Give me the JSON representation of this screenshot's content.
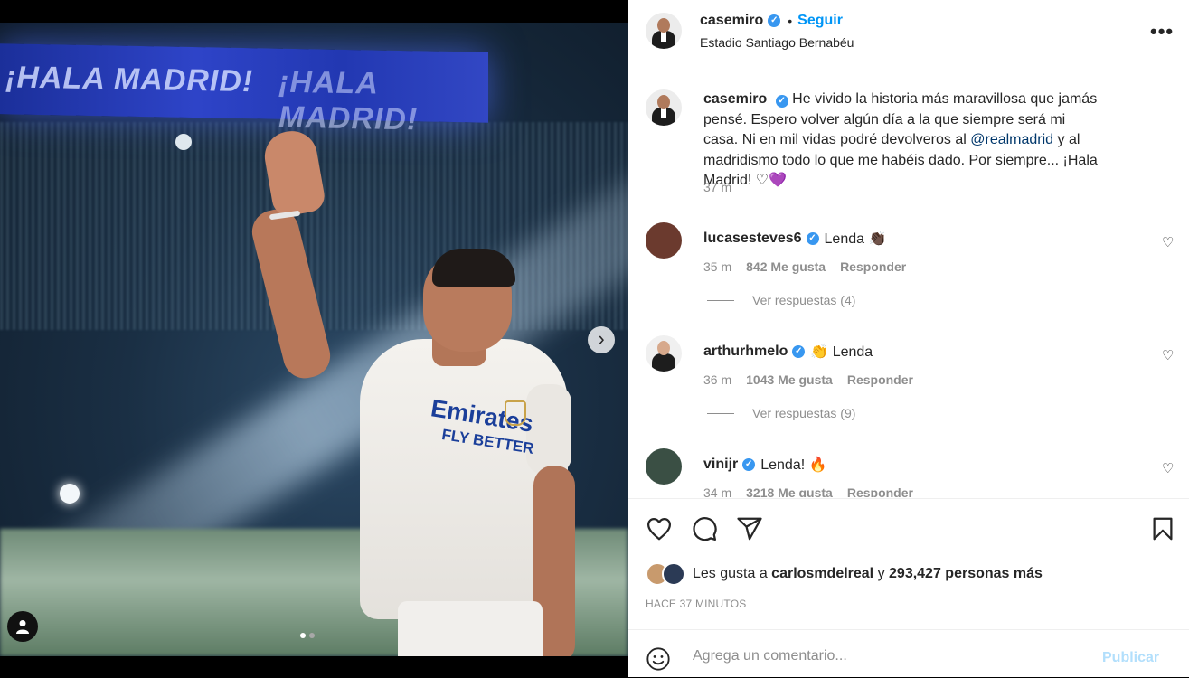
{
  "post": {
    "username": "casemiro",
    "follow_label": "Seguir",
    "separator": "•",
    "location": "Estadio Santiago Bernabéu",
    "more_label": "•••"
  },
  "media": {
    "banner_text": "¡HALA MADRID!",
    "sponsor_line1": "Emirates",
    "sponsor_line2": "FLY BETTER",
    "next_icon": "›",
    "slide_count": 2,
    "active_slide": 0
  },
  "caption": {
    "username": "casemiro",
    "text_before": "He vivido la historia más maravillosa que jamás pensé. Espero volver algún día a la que siempre será mi casa. Ni en mil vidas podré devolveros al ",
    "mention": "@realmadrid",
    "text_after": " y al madridismo todo lo que me habéis dado. Por siempre... ¡Hala Madrid! ",
    "heart_white": "♡",
    "heart_purple": "💜",
    "time": "37 m"
  },
  "comments": [
    {
      "username": "lucasesteves6",
      "text": "Lenda 👏🏿",
      "time": "35 m",
      "likes": "842 Me gusta",
      "reply_label": "Responder",
      "view_replies": "Ver respuestas (4)"
    },
    {
      "username": "arthurhmelo",
      "text": "👏 Lenda",
      "time": "36 m",
      "likes": "1043 Me gusta",
      "reply_label": "Responder",
      "view_replies": "Ver respuestas (9)"
    },
    {
      "username": "vinijr",
      "text": "Lenda! 🔥",
      "time": "34 m",
      "likes": "3218 Me gusta",
      "reply_label": "Responder"
    }
  ],
  "likes": {
    "prefix": "Les gusta a ",
    "user": "carlosmdelreal",
    "middle": " y ",
    "count": "293,427 personas más"
  },
  "time_ago": "HACE 37 MINUTOS",
  "comment_box": {
    "placeholder": "Agrega un comentario...",
    "publish_label": "Publicar"
  },
  "icons": {
    "verified": "✓",
    "heart": "♡"
  },
  "colors": {
    "accent": "#0095f6",
    "publish_disabled": "#b2dffc",
    "verified": "#3897f0",
    "mention": "#00376b"
  }
}
